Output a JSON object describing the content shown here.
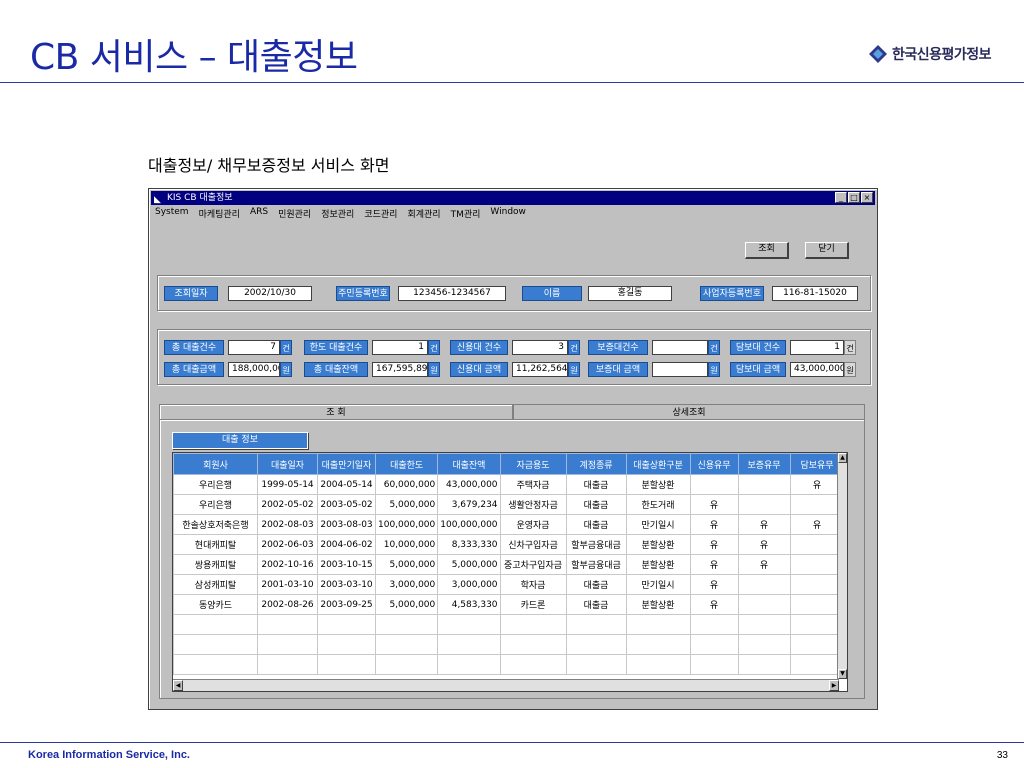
{
  "slide": {
    "title": "CB 서비스 – 대출정보",
    "logo_text": "한국신용평가정보",
    "subtitle": "대출정보/ 채무보증정보 서비스 화면",
    "footer_company": "Korea Information Service, Inc.",
    "page_number": "33"
  },
  "window": {
    "title": "KIS  CB 대출정보",
    "controls": {
      "minimize": "_",
      "maximize": "□",
      "close": "×"
    },
    "menu": [
      "System",
      "마케팅관리",
      "ARS",
      "민원관리",
      "정보관리",
      "코드관리",
      "회계관리",
      "TM관리",
      "Window"
    ],
    "buttons": {
      "search": "조회",
      "close": "닫기"
    }
  },
  "query": {
    "date_label": "조회일자",
    "date_value": "2002/10/30",
    "rrn_label": "주민등록번호",
    "rrn_value": "123456-1234567",
    "name_label": "이름",
    "name_value": "홍길동",
    "brn_label": "사업자등록번호",
    "brn_value": "116-81-15020"
  },
  "summary": {
    "row1": [
      {
        "label": "총 대출건수",
        "value": "7",
        "unit": "건"
      },
      {
        "label": "한도 대출건수",
        "value": "1",
        "unit": "건"
      },
      {
        "label": "신용대 건수",
        "value": "3",
        "unit": "건"
      },
      {
        "label": "보증대건수",
        "value": "",
        "unit": "건"
      },
      {
        "label": "담보대 건수",
        "value": "1",
        "unit": "건"
      }
    ],
    "row2": [
      {
        "label": "총 대출금액",
        "value": "188,000,000",
        "unit": "원"
      },
      {
        "label": "총 대출잔액",
        "value": "167,595,894",
        "unit": "원"
      },
      {
        "label": "신용대 금액",
        "value": "11,262,564",
        "unit": "원"
      },
      {
        "label": "보증대 금액",
        "value": "",
        "unit": "원"
      },
      {
        "label": "담보대 금액",
        "value": "43,000,000",
        "unit": "원"
      }
    ]
  },
  "tabs": {
    "active": "조  회",
    "other": "상세조회"
  },
  "section_label": "대출 정보",
  "table": {
    "columns": [
      "회원사",
      "대출일자",
      "대출만기일자",
      "대출한도",
      "대출잔액",
      "자금용도",
      "계정종류",
      "대출상환구분",
      "신용유무",
      "보증유무",
      "담보유무"
    ],
    "rows": [
      [
        "우리은행",
        "1999-05-14",
        "2004-05-14",
        "60,000,000",
        "43,000,000",
        "주택자금",
        "대출금",
        "분할상환",
        "",
        "",
        "유"
      ],
      [
        "우리은행",
        "2002-05-02",
        "2003-05-02",
        "5,000,000",
        "3,679,234",
        "생활안정자금",
        "대출금",
        "한도거래",
        "유",
        "",
        ""
      ],
      [
        "한솔상호저축은행",
        "2002-08-03",
        "2003-08-03",
        "100,000,000",
        "100,000,000",
        "운영자금",
        "대출금",
        "만기일시",
        "유",
        "유",
        "유"
      ],
      [
        "현대캐피탈",
        "2002-06-03",
        "2004-06-02",
        "10,000,000",
        "8,333,330",
        "신차구입자금",
        "할부금융대금",
        "분할상환",
        "유",
        "유",
        ""
      ],
      [
        "쌍용캐피탈",
        "2002-10-16",
        "2003-10-15",
        "5,000,000",
        "5,000,000",
        "중고차구입자금",
        "할부금융대금",
        "분할상환",
        "유",
        "유",
        ""
      ],
      [
        "삼성캐피탈",
        "2001-03-10",
        "2003-03-10",
        "3,000,000",
        "3,000,000",
        "학자금",
        "대출금",
        "만기일시",
        "유",
        "",
        ""
      ],
      [
        "동양카드",
        "2002-08-26",
        "2003-09-25",
        "5,000,000",
        "4,583,330",
        "카드론",
        "대출금",
        "분할상환",
        "유",
        "",
        ""
      ]
    ],
    "empty_rows": 3
  }
}
